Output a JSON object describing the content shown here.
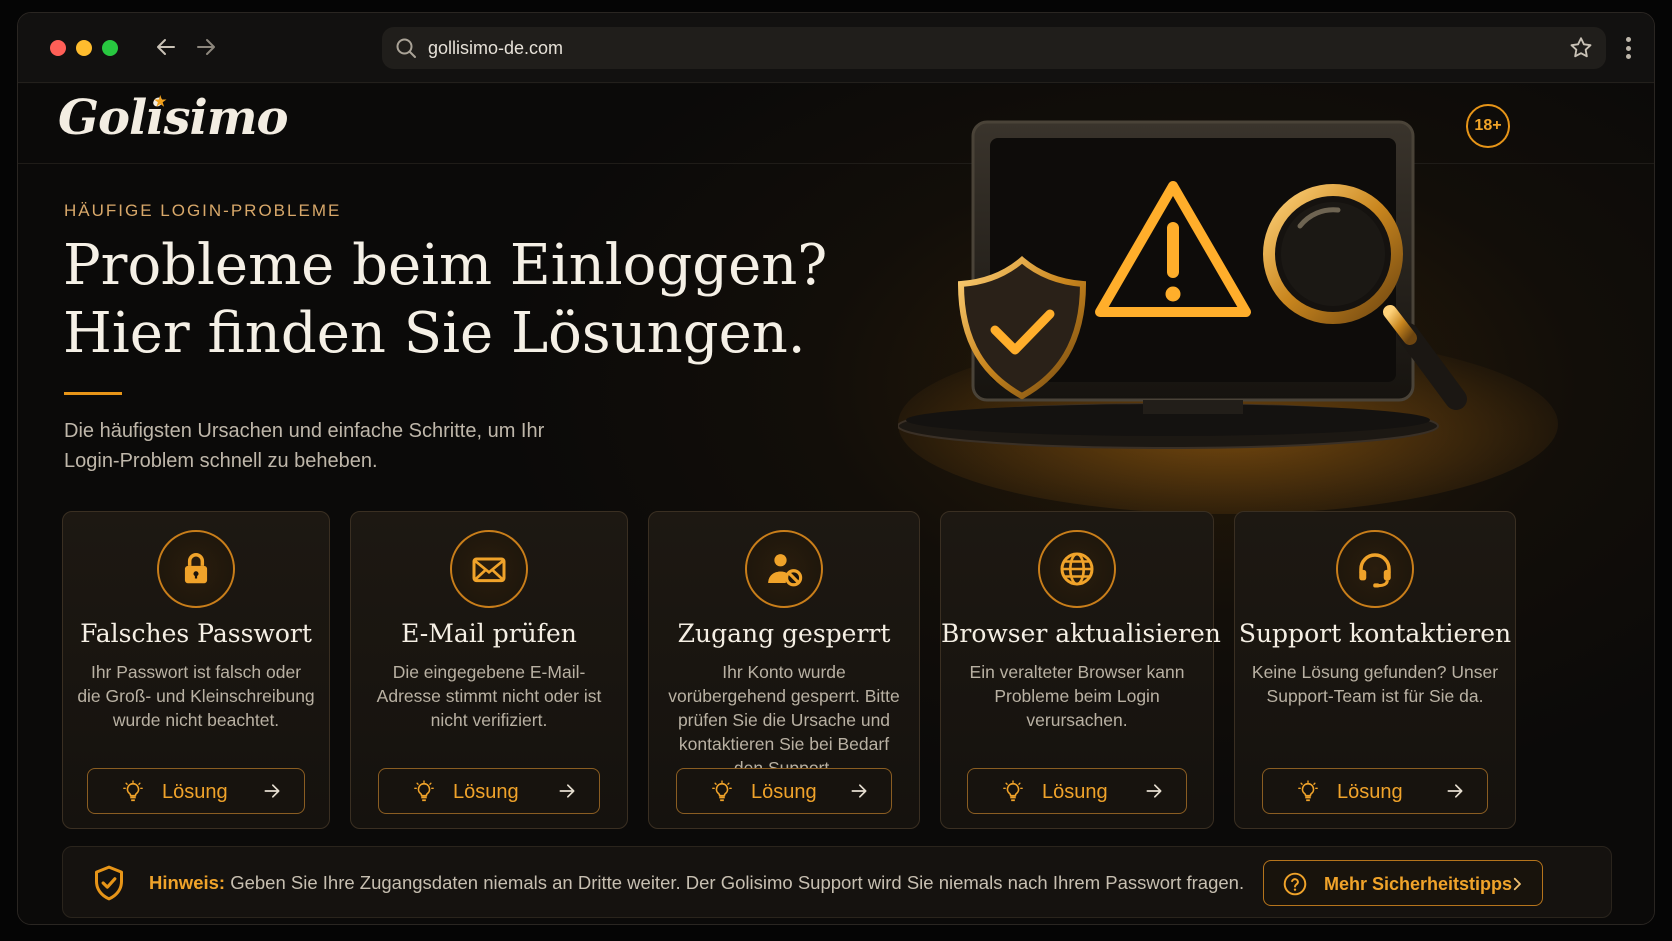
{
  "browser": {
    "url": "gollisimo-de.com",
    "icons": [
      "back-arrow-icon",
      "forward-arrow-icon",
      "search-icon",
      "star-icon",
      "kebab-menu-icon"
    ]
  },
  "site": {
    "logo": "Golisimo",
    "age_badge": "18+",
    "accent_color": "#e79518"
  },
  "hero": {
    "eyebrow": "HÄUFIGE LOGIN-PROBLEME",
    "headline_line1": "Probleme beim Einloggen?",
    "headline_line2": "Hier finden Sie Lösungen.",
    "subtext": "Die häufigsten Ursachen und einfache Schritte, um Ihr Login-Problem schnell zu beheben."
  },
  "cards": [
    {
      "icon": "lock-icon",
      "title": "Falsches Passwort",
      "description": "Ihr Passwort ist falsch oder die Groß- und Kleinschreibung wurde nicht beachtet.",
      "button_label": "Lösung"
    },
    {
      "icon": "mail-icon",
      "title": "E-Mail prüfen",
      "description": "Die eingegebene E-Mail-Adresse stimmt nicht oder ist nicht verifiziert.",
      "button_label": "Lösung"
    },
    {
      "icon": "user-blocked-icon",
      "title": "Zugang gesperrt",
      "description": "Ihr Konto wurde vorübergehend gesperrt. Bitte prüfen Sie die Ursache und kontaktieren Sie bei Bedarf den Support.",
      "button_label": "Lösung"
    },
    {
      "icon": "globe-icon",
      "title": "Browser aktualisieren",
      "description": "Ein veralteter Browser kann Probleme beim Login verursachen.",
      "button_label": "Lösung"
    },
    {
      "icon": "headset-icon",
      "title": "Support kontaktieren",
      "description": "Keine Lösung gefunden? Unser Support-Team ist für Sie da.",
      "button_label": "Lösung"
    }
  ],
  "notice": {
    "label": "Hinweis:",
    "text": " Geben Sie Ihre Zugangsdaten niemals an Dritte weiter. Der Golisimo Support wird Sie niemals nach Ihrem Passwort fragen.",
    "button_label": "Mehr Sicherheitstipps"
  }
}
